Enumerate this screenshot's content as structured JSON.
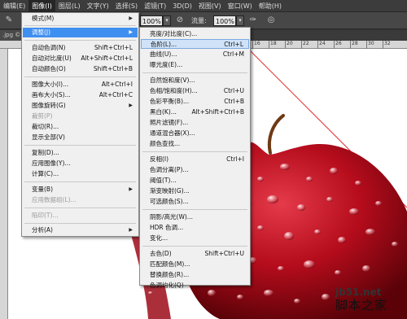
{
  "menubar": {
    "items": [
      {
        "label": "编辑(E)"
      },
      {
        "label": "图像(I)"
      },
      {
        "label": "图层(L)"
      },
      {
        "label": "文字(Y)"
      },
      {
        "label": "选择(S)"
      },
      {
        "label": "滤镜(T)"
      },
      {
        "label": "3D(D)"
      },
      {
        "label": "视图(V)"
      },
      {
        "label": "窗口(W)"
      },
      {
        "label": "帮助(H)"
      }
    ]
  },
  "optionsbar": {
    "opacity_value": "100%",
    "flow_label": "流量:",
    "flow_value": "100%"
  },
  "document_tab": {
    "label": ".jpg ©"
  },
  "ruler": {
    "labels": [
      "16",
      "18",
      "20",
      "22",
      "24",
      "26",
      "28",
      "30",
      "32"
    ]
  },
  "image_menu": {
    "items": [
      {
        "label": "模式(M)",
        "submenu": true
      },
      {
        "label": "调整(J)",
        "submenu": true
      },
      {
        "label": "自动色调(N)",
        "shortcut": "Shift+Ctrl+L"
      },
      {
        "label": "自动对比度(U)",
        "shortcut": "Alt+Shift+Ctrl+L"
      },
      {
        "label": "自动颜色(O)",
        "shortcut": "Shift+Ctrl+B"
      },
      {
        "label": "图像大小(I)...",
        "shortcut": "Alt+Ctrl+I"
      },
      {
        "label": "画布大小(S)...",
        "shortcut": "Alt+Ctrl+C"
      },
      {
        "label": "图像旋转(G)",
        "submenu": true
      },
      {
        "label": "裁剪(P)"
      },
      {
        "label": "裁切(R)..."
      },
      {
        "label": "显示全部(V)"
      },
      {
        "label": "复制(D)..."
      },
      {
        "label": "应用图像(Y)..."
      },
      {
        "label": "计算(C)..."
      },
      {
        "label": "变量(B)",
        "submenu": true
      },
      {
        "label": "应用数据组(L)..."
      },
      {
        "label": "陷印(T)..."
      },
      {
        "label": "分析(A)",
        "submenu": true
      }
    ]
  },
  "adjust_menu": {
    "items": [
      {
        "label": "亮度/对比度(C)..."
      },
      {
        "label": "色阶(L)...",
        "shortcut": "Ctrl+L"
      },
      {
        "label": "曲线(U)...",
        "shortcut": "Ctrl+M"
      },
      {
        "label": "曝光度(E)..."
      },
      {
        "label": "自然饱和度(V)..."
      },
      {
        "label": "色相/饱和度(H)...",
        "shortcut": "Ctrl+U"
      },
      {
        "label": "色彩平衡(B)...",
        "shortcut": "Ctrl+B"
      },
      {
        "label": "黑白(K)...",
        "shortcut": "Alt+Shift+Ctrl+B"
      },
      {
        "label": "照片滤镜(F)..."
      },
      {
        "label": "通道混合器(X)..."
      },
      {
        "label": "颜色查找..."
      },
      {
        "label": "反相(I)",
        "shortcut": "Ctrl+I"
      },
      {
        "label": "色调分离(P)..."
      },
      {
        "label": "阈值(T)..."
      },
      {
        "label": "渐变映射(G)..."
      },
      {
        "label": "可选颜色(S)..."
      },
      {
        "label": "阴影/高光(W)..."
      },
      {
        "label": "HDR 色调..."
      },
      {
        "label": "变化..."
      },
      {
        "label": "去色(D)",
        "shortcut": "Shift+Ctrl+U"
      },
      {
        "label": "匹配颜色(M)..."
      },
      {
        "label": "替换颜色(R)..."
      },
      {
        "label": "色调均化(Q)"
      }
    ]
  },
  "watermark": {
    "url": "jb51.net",
    "name": "脚本之家"
  },
  "colors": {
    "menu_highlight": "#3f8ff0",
    "apple_red": "#c0101e",
    "annotation_line": "#e03030"
  }
}
